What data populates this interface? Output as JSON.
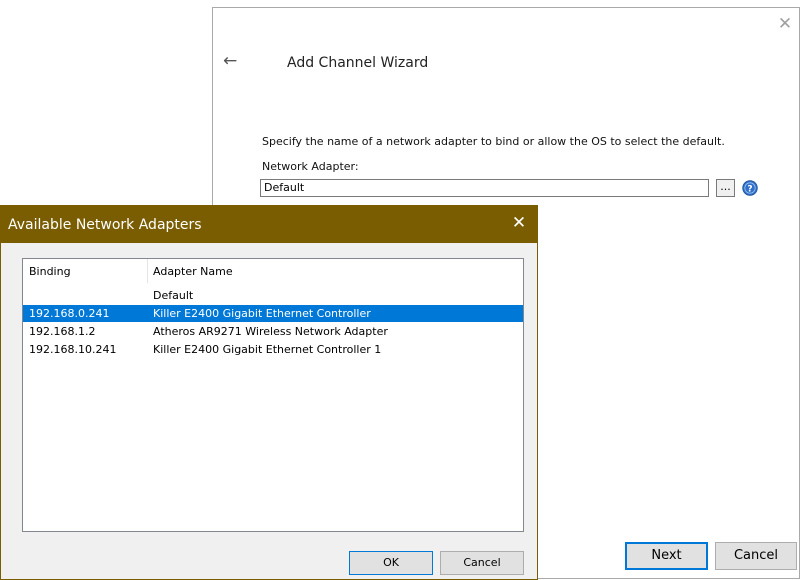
{
  "wizard": {
    "title": "Add Channel Wizard",
    "instruction": "Specify the name of a network adapter to bind or allow the OS to select the default.",
    "adapter_label": "Network Adapter:",
    "adapter_value": "Default",
    "browse_label": "...",
    "next_label": "Next",
    "cancel_label": "Cancel"
  },
  "dialog": {
    "title": "Available Network Adapters",
    "columns": [
      "Binding",
      "Adapter Name"
    ],
    "rows": [
      {
        "binding": "",
        "name": "Default",
        "selected": false
      },
      {
        "binding": "192.168.0.241",
        "name": "Killer E2400 Gigabit Ethernet Controller",
        "selected": true
      },
      {
        "binding": "192.168.1.2",
        "name": "Atheros AR9271 Wireless Network Adapter",
        "selected": false
      },
      {
        "binding": "192.168.10.241",
        "name": "Killer E2400 Gigabit Ethernet Controller 1",
        "selected": false
      }
    ],
    "ok_label": "OK",
    "cancel_label": "Cancel",
    "titlebar_color": "#7a5d00",
    "selection_color": "#0078d7"
  }
}
